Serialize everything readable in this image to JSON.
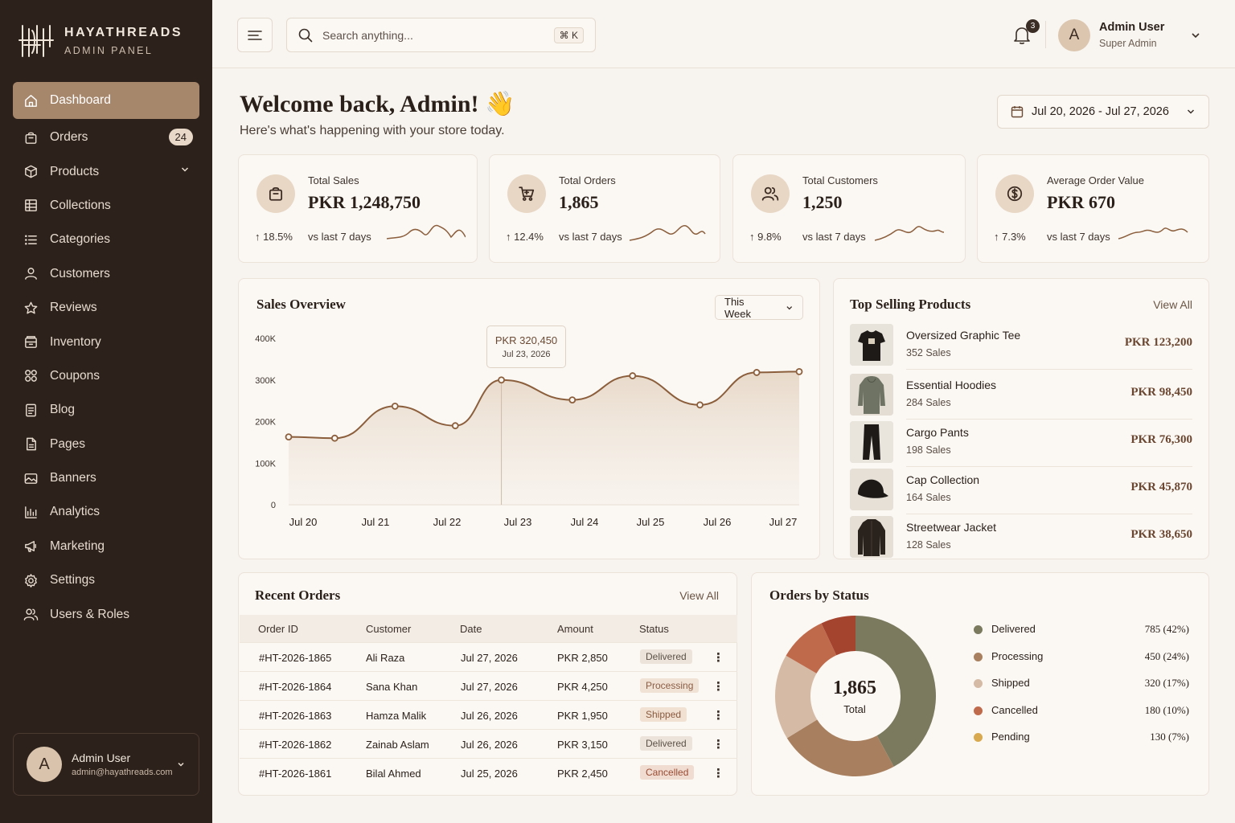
{
  "brand": {
    "name": "HAYATHREADS",
    "sub": "ADMIN PANEL"
  },
  "sidebar": {
    "items": [
      {
        "label": "Dashboard",
        "icon": "home-icon",
        "active": true
      },
      {
        "label": "Orders",
        "icon": "bag-icon",
        "badge": "24"
      },
      {
        "label": "Products",
        "icon": "box-icon",
        "chevron": true
      },
      {
        "label": "Collections",
        "icon": "grid-icon"
      },
      {
        "label": "Categories",
        "icon": "list-icon"
      },
      {
        "label": "Customers",
        "icon": "user-icon"
      },
      {
        "label": "Reviews",
        "icon": "star-icon"
      },
      {
        "label": "Inventory",
        "icon": "inventory-icon"
      },
      {
        "label": "Coupons",
        "icon": "coupon-icon"
      },
      {
        "label": "Blog",
        "icon": "doc-icon"
      },
      {
        "label": "Pages",
        "icon": "page-icon"
      },
      {
        "label": "Banners",
        "icon": "image-icon"
      },
      {
        "label": "Analytics",
        "icon": "chart-icon"
      },
      {
        "label": "Marketing",
        "icon": "megaphone-icon"
      },
      {
        "label": "Settings",
        "icon": "gear-icon"
      },
      {
        "label": "Users & Roles",
        "icon": "users-icon"
      }
    ],
    "user": {
      "initial": "A",
      "name": "Admin User",
      "email": "admin@hayathreads.com"
    }
  },
  "topbar": {
    "search_placeholder": "Search anything...",
    "shortcut": "⌘  K",
    "notifications": "3",
    "user": {
      "initial": "A",
      "name": "Admin User",
      "role": "Super Admin"
    }
  },
  "welcome": {
    "title": "Welcome back, Admin! 👋",
    "subtitle": "Here's what's happening with your store today."
  },
  "date_range": "Jul 20, 2026 - Jul 27, 2026",
  "stats": [
    {
      "label": "Total Sales",
      "value": "PKR 1,248,750",
      "trend": "↑ 18.5%",
      "vs": "vs last 7 days",
      "icon": "bag-icon"
    },
    {
      "label": "Total Orders",
      "value": "1,865",
      "trend": "↑ 12.4%",
      "vs": "vs last 7 days",
      "icon": "cart-icon"
    },
    {
      "label": "Total Customers",
      "value": "1,250",
      "trend": "↑ 9.8%",
      "vs": "vs last 7 days",
      "icon": "users-icon"
    },
    {
      "label": "Average Order Value",
      "value": "PKR 670",
      "trend": "↑ 7.3%",
      "vs": "vs last 7 days",
      "icon": "dollar-icon"
    }
  ],
  "sales_overview": {
    "title": "Sales Overview",
    "period": "This Week",
    "tooltip": {
      "value": "PKR 320,450",
      "date": "Jul 23, 2026"
    }
  },
  "chart_data": {
    "type": "area",
    "title": "Sales Overview",
    "categories": [
      "Jul 20",
      "Jul 21",
      "Jul 22",
      "Jul 23",
      "Jul 24",
      "Jul 25",
      "Jul 26",
      "Jul 27"
    ],
    "y_ticks": [
      "400K",
      "300K",
      "200K",
      "100K",
      "0"
    ],
    "ylim": [
      0,
      400000
    ],
    "points": [
      {
        "x": 0.0,
        "y": 163000
      },
      {
        "x": 0.65,
        "y": 160000
      },
      {
        "x": 1.5,
        "y": 237000
      },
      {
        "x": 2.35,
        "y": 190000
      },
      {
        "x": 3.0,
        "y": 300000
      },
      {
        "x": 4.0,
        "y": 252000
      },
      {
        "x": 4.85,
        "y": 310000
      },
      {
        "x": 5.8,
        "y": 240000
      },
      {
        "x": 6.6,
        "y": 318000
      },
      {
        "x": 7.2,
        "y": 320000
      }
    ],
    "highlight": {
      "category": "Jul 23",
      "value": 320450
    },
    "grid": false
  },
  "top_products": {
    "title": "Top Selling Products",
    "view_all": "View All",
    "items": [
      {
        "name": "Oversized Graphic Tee",
        "sales": "352 Sales",
        "price": "PKR 123,200",
        "thumb": "tshirt"
      },
      {
        "name": "Essential Hoodies",
        "sales": "284 Sales",
        "price": "PKR 98,450",
        "thumb": "hoodie"
      },
      {
        "name": "Cargo Pants",
        "sales": "198 Sales",
        "price": "PKR 76,300",
        "thumb": "pants"
      },
      {
        "name": "Cap Collection",
        "sales": "164 Sales",
        "price": "PKR 45,870",
        "thumb": "cap"
      },
      {
        "name": "Streetwear Jacket",
        "sales": "128 Sales",
        "price": "PKR 38,650",
        "thumb": "jacket"
      }
    ]
  },
  "recent_orders": {
    "title": "Recent Orders",
    "view_all": "View All",
    "columns": [
      "Order ID",
      "Customer",
      "Date",
      "Amount",
      "Status"
    ],
    "rows": [
      {
        "id": "#HT-2026-1865",
        "customer": "Ali Raza",
        "date": "Jul 27, 2026",
        "amount": "PKR 2,850",
        "status": "Delivered"
      },
      {
        "id": "#HT-2026-1864",
        "customer": "Sana Khan",
        "date": "Jul 27, 2026",
        "amount": "PKR 4,250",
        "status": "Processing"
      },
      {
        "id": "#HT-2026-1863",
        "customer": "Hamza Malik",
        "date": "Jul 26, 2026",
        "amount": "PKR 1,950",
        "status": "Shipped"
      },
      {
        "id": "#HT-2026-1862",
        "customer": "Zainab Aslam",
        "date": "Jul 26, 2026",
        "amount": "PKR 3,150",
        "status": "Delivered"
      },
      {
        "id": "#HT-2026-1861",
        "customer": "Bilal Ahmed",
        "date": "Jul 25, 2026",
        "amount": "PKR 2,450",
        "status": "Cancelled"
      }
    ],
    "status_colors": {
      "Delivered": {
        "bg": "#ece4da",
        "fg": "#5d5148"
      },
      "Processing": {
        "bg": "#f1e2d6",
        "fg": "#8b5e45"
      },
      "Shipped": {
        "bg": "#f0e1d3",
        "fg": "#8a5a3e"
      },
      "Cancelled": {
        "bg": "#f0dcd0",
        "fg": "#9a4c34"
      }
    }
  },
  "orders_by_status": {
    "title": "Orders by Status",
    "total": "1,865",
    "total_label": "Total",
    "legend": [
      {
        "label": "Delivered",
        "value": "785 (42%)",
        "count": 785,
        "color": "#7b7a5f"
      },
      {
        "label": "Processing",
        "value": "450 (24%)",
        "count": 450,
        "color": "#a8805f"
      },
      {
        "label": "Shipped",
        "value": "320 (17%)",
        "count": 320,
        "color": "#d5bba6"
      },
      {
        "label": "Cancelled",
        "value": "180 (10%)",
        "count": 180,
        "color": "#c06a4c"
      },
      {
        "label": "Pending",
        "value": "130 (7%)",
        "count": 130,
        "color": "#a4432e"
      }
    ],
    "legend_pending_dot": "#d8a94e"
  },
  "colors": {
    "sidebar": "#2c211b",
    "accent": "#a7876c",
    "line": "#8b5e3c",
    "background": "#f7f3ee"
  }
}
